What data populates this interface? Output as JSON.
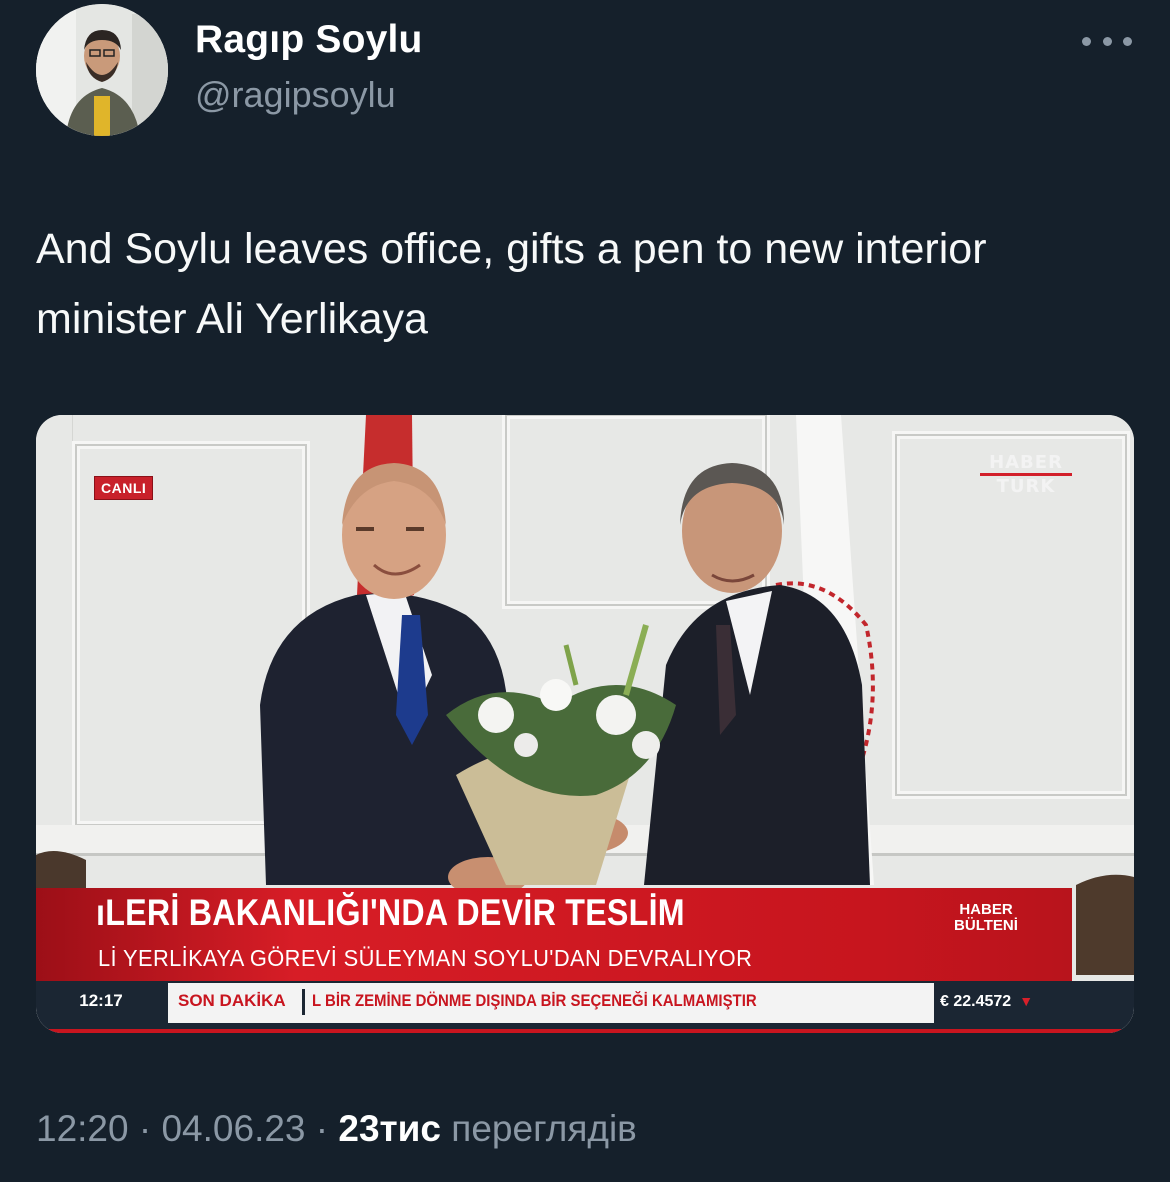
{
  "author": {
    "display_name": "Ragıp Soylu",
    "handle": "@ragipsoylu"
  },
  "tweet": {
    "text": "And Soylu leaves office, gifts a pen to new interior minister Ali Yerlikaya"
  },
  "media": {
    "live_badge": "CANLI",
    "channel_logo": {
      "line1": "HABER",
      "line2": "TURK"
    },
    "headline": "ıLERİ BAKANLIĞI'NDA DEVİR TESLİM",
    "subheadline": "Lİ YERLİKAYA GÖREVİ SÜLEYMAN SOYLU'DAN DEVRALIYOR",
    "program_line1": "HABER",
    "program_line2": "BÜLTENİ",
    "ticker_time": "12:17",
    "ticker_label": "SON DAKİKA",
    "ticker_text": "L BİR ZEMİNE DÖNME DIŞINDA BİR SEÇENEĞİ KALMAMIŞTIR",
    "currency": "€ 22.4572"
  },
  "meta": {
    "time": "12:20",
    "separator": "·",
    "date": "04.06.23",
    "views_count": "23тис",
    "views_label": "переглядів"
  },
  "colors": {
    "background": "#15202b",
    "secondary_text": "#8b98a5",
    "news_red": "#c8151f"
  },
  "icons": {
    "more": "more-horizontal-icon",
    "currency_trend": "down-arrow-icon"
  }
}
